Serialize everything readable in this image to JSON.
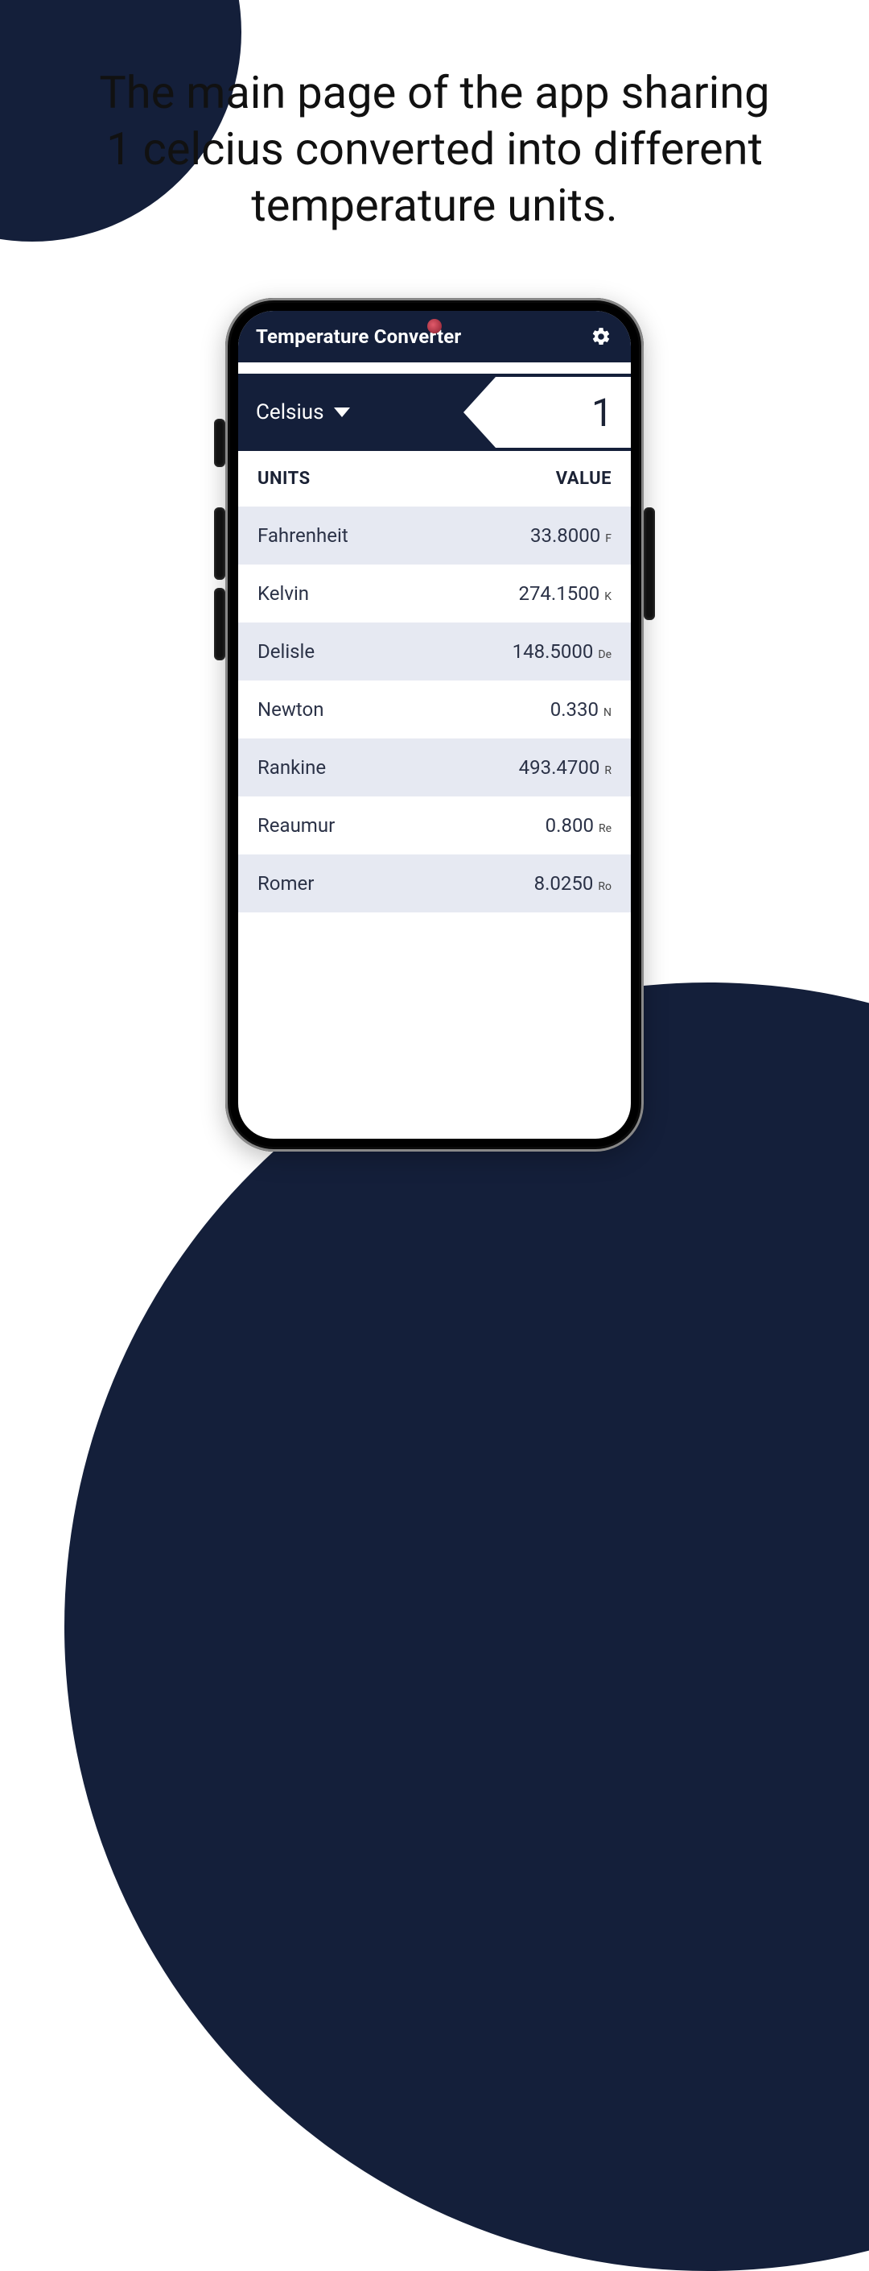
{
  "promo": {
    "headline": "The main page of the app sharing 1 celcius converted into different temperature units."
  },
  "appbar": {
    "title": "Temperature Converter"
  },
  "input": {
    "selected_unit": "Celsius",
    "value": "1"
  },
  "table": {
    "units_header": "UNITS",
    "value_header": "VALUE",
    "rows": [
      {
        "name": "Fahrenheit",
        "value": "33.8000",
        "symbol": "F"
      },
      {
        "name": "Kelvin",
        "value": "274.1500",
        "symbol": "K"
      },
      {
        "name": "Delisle",
        "value": "148.5000",
        "symbol": "De"
      },
      {
        "name": "Newton",
        "value": "0.330",
        "symbol": "N"
      },
      {
        "name": "Rankine",
        "value": "493.4700",
        "symbol": "R"
      },
      {
        "name": "Reaumur",
        "value": "0.800",
        "symbol": "Re"
      },
      {
        "name": "Romer",
        "value": "8.0250",
        "symbol": "Ro"
      }
    ]
  },
  "colors": {
    "brand_dark": "#141f3a",
    "row_alt": "#e6e9f2"
  }
}
